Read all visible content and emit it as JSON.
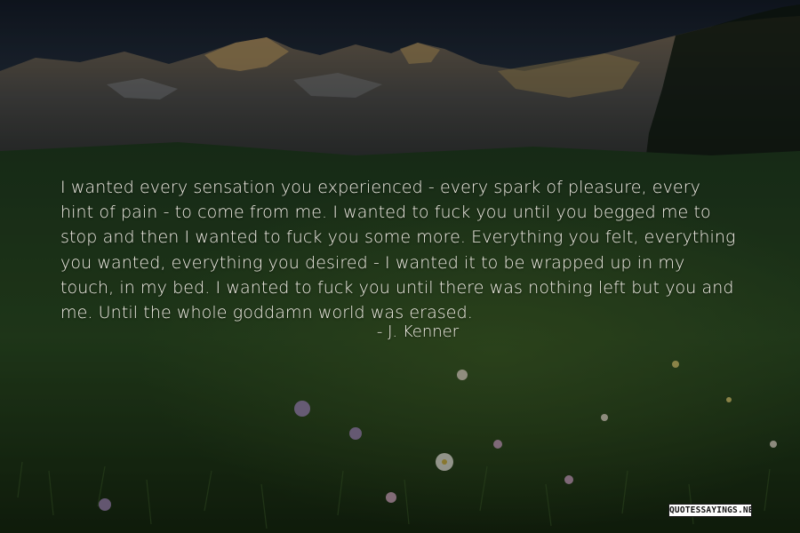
{
  "quote": {
    "lines": [
      "I wanted every sensation you experienced -  every spark of pleasure, every",
      "hint of pain -  to come from me. I wanted to fuck you until you begged me to",
      "stop and then I wanted to fuck you some more. Everything you felt, everything",
      "you wanted, everything you desired -  I wanted it to be wrapped up in my",
      "touch, in my bed. I wanted to fuck you until there was nothing left but you and",
      "me. Until the whole goddamn world was erased."
    ],
    "author": "- J. Kenner"
  },
  "watermark": {
    "text": "QUOTESSAYINGS.NET"
  },
  "colors": {
    "text": "#f2efe6",
    "sky": "#1b2433",
    "meadow": "#1a321c"
  }
}
